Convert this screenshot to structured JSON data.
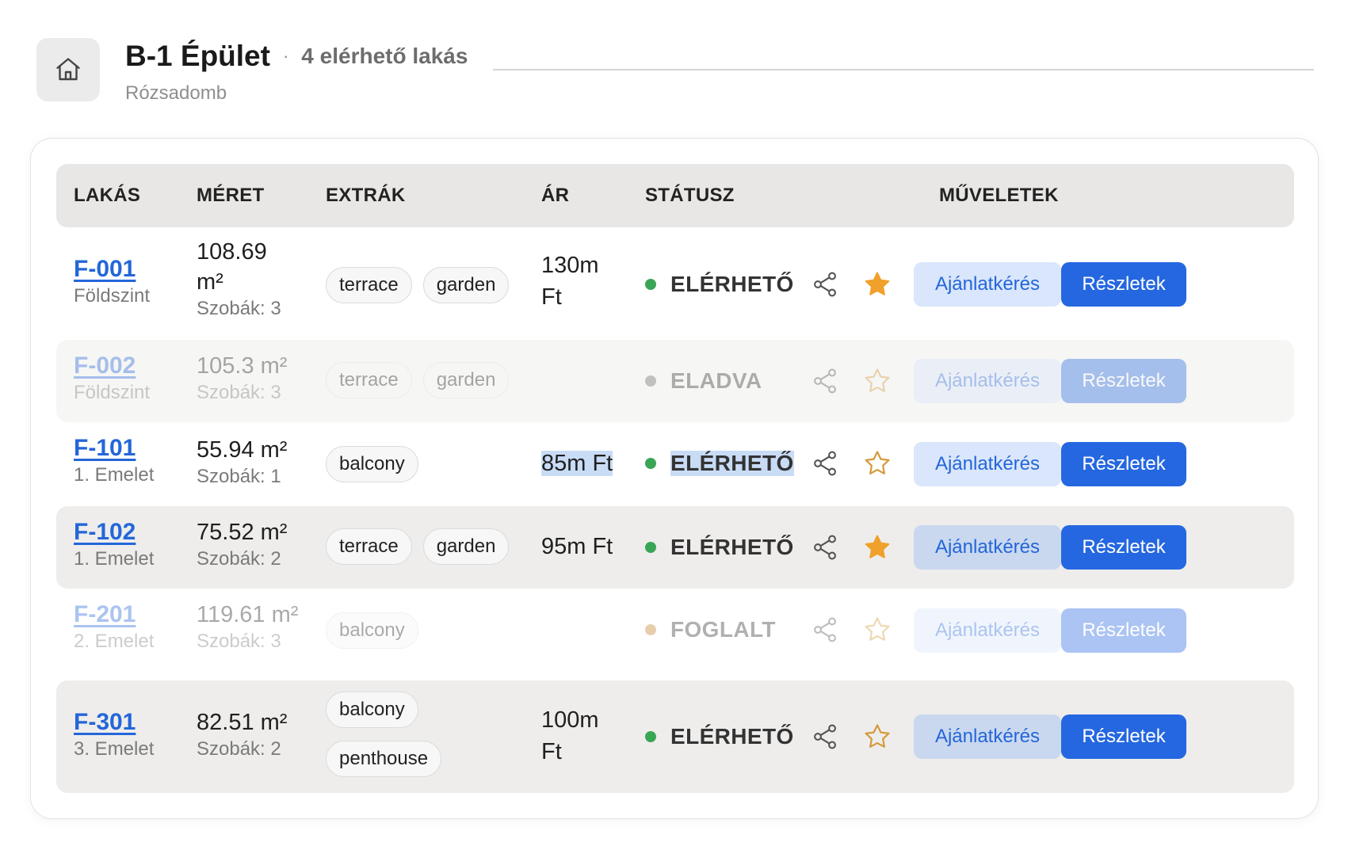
{
  "header": {
    "title": "B-1 Épület",
    "separator": "·",
    "available": "4 elérhető lakás",
    "location": "Rózsadomb"
  },
  "table": {
    "columns": [
      "LAKÁS",
      "MÉRET",
      "EXTRÁK",
      "ÁR",
      "STÁTUSZ",
      "MŰVELETEK"
    ],
    "rows": [
      {
        "id": "F-001",
        "floor": "Földszint",
        "size_a": "108.69",
        "size_b": "m²",
        "rooms": "Szobák: 3",
        "extras": [
          "terrace",
          "garden"
        ],
        "price_a": "130m",
        "price_b": "Ft",
        "status": "ELÉRHETŐ",
        "status_color": "#3aa655",
        "favorite": true,
        "quote": "Ajánlatkérés",
        "details": "Részletek"
      },
      {
        "id": "F-002",
        "floor": "Földszint",
        "size": "105.3 m²",
        "rooms": "Szobák: 3",
        "extras": [
          "terrace",
          "garden"
        ],
        "price": "",
        "status": "ELADVA",
        "status_color": "#9a9a9a",
        "favorite": false,
        "quote": "Ajánlatkérés",
        "details": "Részletek"
      },
      {
        "id": "F-101",
        "floor": "1. Emelet",
        "size": "55.94 m²",
        "rooms": "Szobák: 1",
        "extras": [
          "balcony"
        ],
        "price": "85m Ft",
        "status": "ELÉRHETŐ",
        "status_color": "#3aa655",
        "favorite": false,
        "quote": "Ajánlatkérés",
        "details": "Részletek"
      },
      {
        "id": "F-102",
        "floor": "1. Emelet",
        "size": "75.52 m²",
        "rooms": "Szobák: 2",
        "extras": [
          "terrace",
          "garden"
        ],
        "price": "95m Ft",
        "status": "ELÉRHETŐ",
        "status_color": "#3aa655",
        "favorite": true,
        "quote": "Ajánlatkérés",
        "details": "Részletek"
      },
      {
        "id": "F-201",
        "floor": "2. Emelet",
        "size": "119.61 m²",
        "rooms": "Szobák: 3",
        "extras": [
          "balcony"
        ],
        "price": "",
        "status": "FOGLALT",
        "status_color": "#e0a04a",
        "favorite": false,
        "quote": "Ajánlatkérés",
        "details": "Részletek"
      },
      {
        "id": "F-301",
        "floor": "3. Emelet",
        "size": "82.51 m²",
        "rooms": "Szobák: 2",
        "extras": [
          "balcony",
          "penthouse"
        ],
        "price_a": "100m",
        "price_b": "Ft",
        "status": "ELÉRHETŐ",
        "status_color": "#3aa655",
        "favorite": false,
        "quote": "Ajánlatkérés",
        "details": "Részletek"
      }
    ]
  },
  "colors": {
    "accent": "#2567e0",
    "star_filled": "#f0a12b",
    "star_outline": "#d49a3a"
  },
  "icons": {
    "home": "home-icon",
    "share": "share-icon",
    "favorite": "star-icon"
  }
}
